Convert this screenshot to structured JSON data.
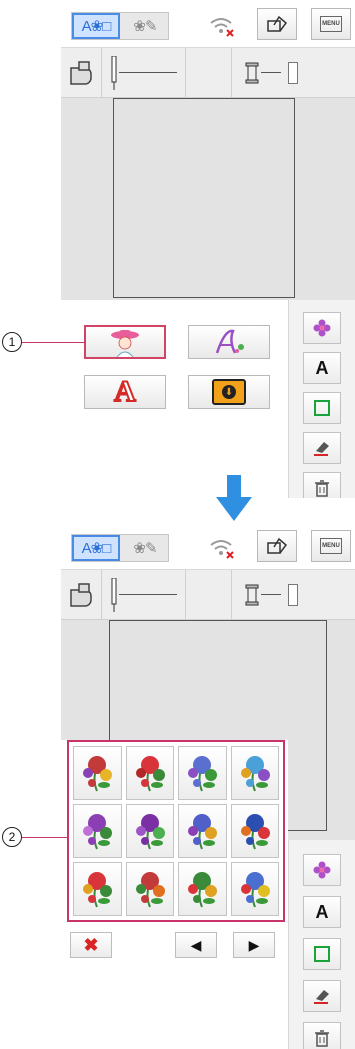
{
  "screens": [
    {
      "topbar": {
        "mode_left": "A❀□",
        "mode_right": "❀✎",
        "menu_label": "MENU"
      },
      "callout": "1",
      "categories": [
        "Embroidery pattern",
        "Script alphabet",
        "Alphabet",
        "Saved designs"
      ]
    },
    {
      "topbar": {
        "mode_left": "A❀□",
        "mode_right": "❀✎",
        "menu_label": "MENU"
      },
      "callout": "2",
      "patterns_count": 12,
      "nav": {
        "close": "✖",
        "prev": "◀",
        "next": "▶"
      }
    }
  ],
  "sidebar": {
    "letter": "A"
  },
  "colors": {
    "accent_blue": "#2f8fe0",
    "selection_pink": "#c8336a",
    "delete_red": "#d82424",
    "folder_orange": "#f2a21a",
    "frame_green": "#1aa33a"
  },
  "icons": [
    "flower-icon",
    "letter-a-icon",
    "square-icon",
    "eraser-icon",
    "trash-icon",
    "wifi-off-icon",
    "frame-icon",
    "menu-icon",
    "presser-foot-icon",
    "needle-icon",
    "spool-icon"
  ]
}
